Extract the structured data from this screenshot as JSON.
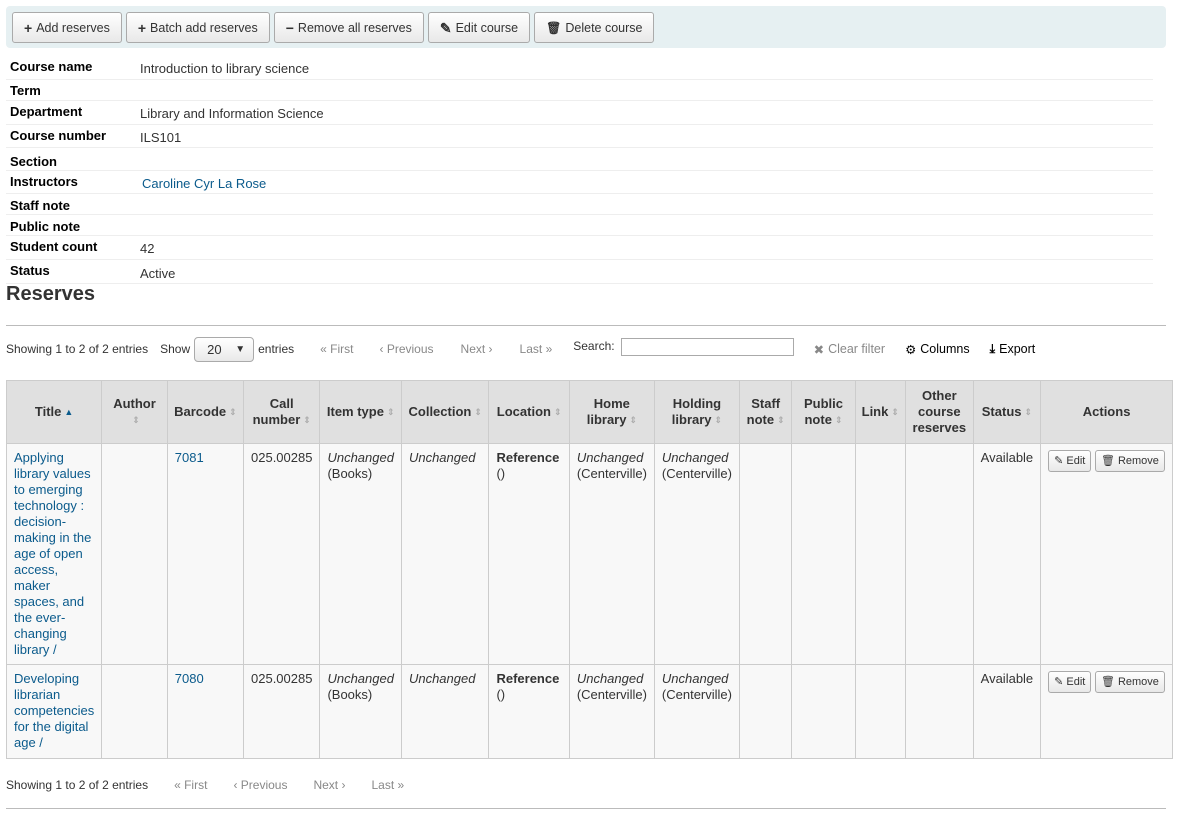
{
  "toolbar": {
    "add_reserves": "Add reserves",
    "batch_add_reserves": "Batch add reserves",
    "remove_all_reserves": "Remove all reserves",
    "edit_course": "Edit course",
    "delete_course": "Delete course"
  },
  "course": {
    "name_label": "Course name",
    "name": "Introduction to library science",
    "term_label": "Term",
    "term": "",
    "department_label": "Department",
    "department": "Library and Information Science",
    "number_label": "Course number",
    "number": "ILS101",
    "section_label": "Section",
    "section": "",
    "instructors_label": "Instructors",
    "instructor": "Caroline Cyr La Rose",
    "staff_note_label": "Staff note",
    "staff_note": "",
    "public_note_label": "Public note",
    "public_note": "",
    "student_count_label": "Student count",
    "student_count": "42",
    "status_label": "Status",
    "status": "Active"
  },
  "reserves_heading": "Reserves",
  "pager": {
    "info": "Showing 1 to 2 of 2 entries",
    "show": "Show",
    "page_size": "20",
    "entries": "entries",
    "first": "« First",
    "previous": "‹ Previous",
    "next": "Next ›",
    "last": "Last »",
    "search_label": "Search:",
    "clear_filter": "Clear filter",
    "columns": "Columns",
    "export": "Export"
  },
  "table": {
    "headers": {
      "title": "Title",
      "author": "Author",
      "barcode": "Barcode",
      "call_number": "Call number",
      "item_type": "Item type",
      "collection": "Collection",
      "location": "Location",
      "home_library": "Home library",
      "holding_library": "Holding library",
      "staff_note": "Staff note",
      "public_note": "Public note",
      "link": "Link",
      "other_reserves": "Other course reserves",
      "status": "Status",
      "actions": "Actions"
    },
    "rows": [
      {
        "title": "Applying library values to emerging technology : decision-making in the age of open access, maker spaces, and the ever-changing library /",
        "author": "",
        "barcode": "7081",
        "call_number": "025.00285",
        "item_type_main": "Unchanged",
        "item_type_sub": "(Books)",
        "collection": "Unchanged",
        "location_main": "Reference",
        "location_sub": "()",
        "home_main": "Unchanged",
        "home_sub": "(Centerville)",
        "holding_main": "Unchanged",
        "holding_sub": "(Centerville)",
        "status": "Available",
        "edit": "Edit",
        "remove": "Remove"
      },
      {
        "title": "Developing librarian competencies for the digital age /",
        "author": "",
        "barcode": "7080",
        "call_number": "025.00285",
        "item_type_main": "Unchanged",
        "item_type_sub": "(Books)",
        "collection": "Unchanged",
        "location_main": "Reference",
        "location_sub": "()",
        "home_main": "Unchanged",
        "home_sub": "(Centerville)",
        "holding_main": "Unchanged",
        "holding_sub": "(Centerville)",
        "status": "Available",
        "edit": "Edit",
        "remove": "Remove"
      }
    ]
  },
  "colors": {
    "link": "#0b5b8c",
    "toolbar_bg": "#e6f0f2",
    "header_bg": "#e0e0e0"
  },
  "icons": [
    "plus-icon",
    "minus-icon",
    "pencil-icon",
    "trash-icon",
    "gear-icon",
    "download-icon",
    "close-icon",
    "chevron-down-icon",
    "sort-icon"
  ]
}
